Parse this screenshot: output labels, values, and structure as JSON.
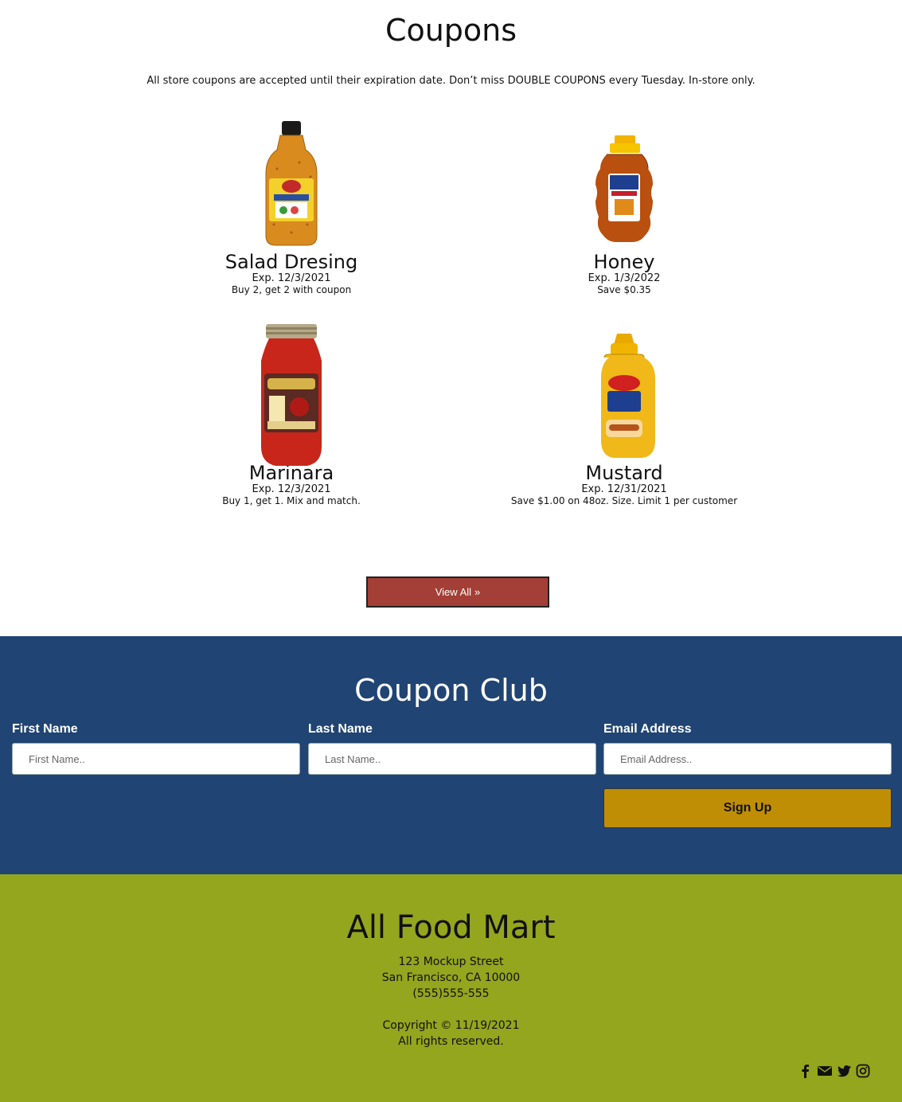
{
  "coupons": {
    "title": "Coupons",
    "intro": "All store coupons are accepted until their expiration date. Don’t miss DOUBLE COUPONS every Tuesday. In-store only.",
    "items": [
      {
        "name": "Salad Dresing",
        "exp": "Exp. 12/3/2021",
        "deal": "Buy 2, get 2 with coupon",
        "image": "salad-dressing-bottle"
      },
      {
        "name": "Honey",
        "exp": "Exp. 1/3/2022",
        "deal": "Save $0.35",
        "image": "honey-bottle"
      },
      {
        "name": "Marinara",
        "exp": "Exp. 12/3/2021",
        "deal": "Buy 1, get 1. Mix and match.",
        "image": "marinara-jar"
      },
      {
        "name": "Mustard",
        "exp": "Exp. 12/31/2021",
        "deal": "Save $1.00 on 48oz. Size. Limit 1 per customer",
        "image": "mustard-bottle"
      }
    ],
    "view_all_label": "View All",
    "view_all_icon": "»",
    "colors": {
      "button": "#a33f36"
    }
  },
  "club": {
    "title": "Coupon Club",
    "first_name_label": "First Name",
    "first_name_placeholder": "First Name..",
    "last_name_label": "Last Name",
    "last_name_placeholder": "Last Name..",
    "email_label": "Email Address",
    "email_placeholder": "Email Address..",
    "signup_label": "Sign Up",
    "colors": {
      "background": "#204473",
      "button": "#c08e05"
    }
  },
  "footer": {
    "store_name": "All Food Mart",
    "street": "123 Mockup Street",
    "city": "San Francisco, CA 10000",
    "phone": "(555)555-555",
    "copyright": "Copyright © 11/19/2021",
    "rights": "All rights reserved.",
    "social_icons": [
      "facebook-icon",
      "envelope-icon",
      "twitter-icon",
      "instagram-icon"
    ],
    "colors": {
      "background": "#94a51e"
    }
  }
}
